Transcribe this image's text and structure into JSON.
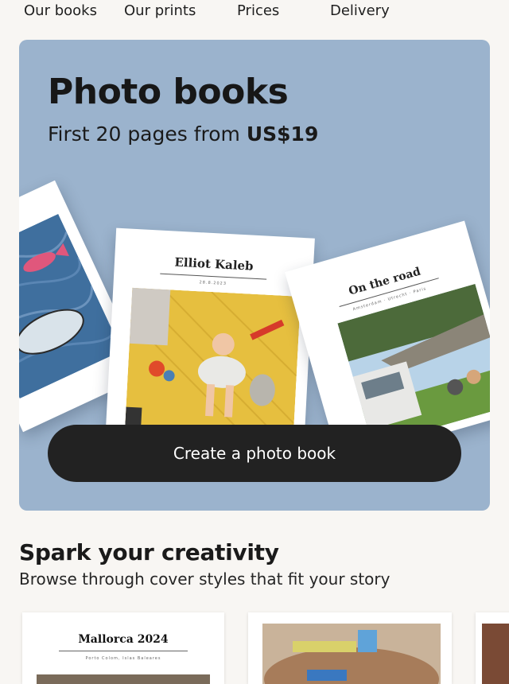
{
  "nav": {
    "items": [
      {
        "label": "Our books"
      },
      {
        "label": "Our prints"
      },
      {
        "label": "Prices"
      },
      {
        "label": "Delivery"
      }
    ]
  },
  "hero": {
    "title": "Photo books",
    "subtitle_prefix": "First 20 pages from ",
    "subtitle_price": "US$19",
    "cta_label": "Create a photo book",
    "background_color": "#9bb3cd"
  },
  "books": {
    "center": {
      "title": "Elliot Kaleb",
      "meta": "28.8.2023"
    },
    "right": {
      "title": "On the road",
      "meta": "Amsterdam · Utrecht · Paris"
    }
  },
  "section": {
    "title": "Spark your creativity",
    "subtitle": "Browse through cover styles that fit your story"
  },
  "cards": [
    {
      "title": "Mallorca 2024",
      "meta": "Porto Colom, Islas Baleares"
    }
  ]
}
